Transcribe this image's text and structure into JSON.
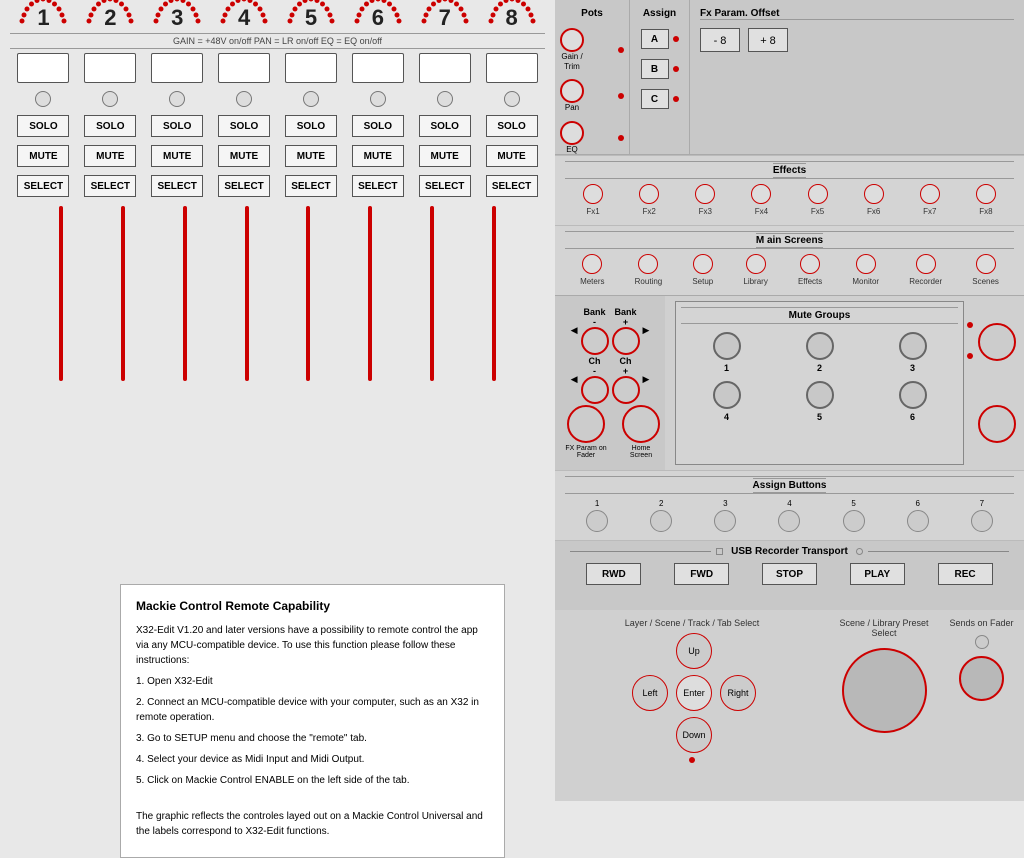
{
  "channels": {
    "numbers": [
      "1",
      "2",
      "3",
      "4",
      "5",
      "6",
      "7",
      "8"
    ],
    "gain_label": "GAIN = +48V on/off   PAN = LR on/off   EQ = EQ on/off",
    "solo_label": "SOLO",
    "mute_label": "MUTE",
    "select_label": "SELECT"
  },
  "pots": {
    "label": "Pots",
    "gain_trim": "Gain /\nTrim",
    "pan": "Pan",
    "eq": "EQ"
  },
  "assign": {
    "label": "Assign",
    "buttons": [
      "A",
      "B",
      "C"
    ]
  },
  "fx_param": {
    "title": "Fx Param. Offset",
    "minus8": "- 8",
    "plus8": "+ 8"
  },
  "effects": {
    "title": "Effects",
    "items": [
      "Fx1",
      "Fx2",
      "Fx3",
      "Fx4",
      "Fx5",
      "Fx6",
      "Fx7",
      "Fx8"
    ]
  },
  "main_screens": {
    "title": "M ain Screens",
    "items": [
      "Meters",
      "Routing",
      "Setup",
      "Library",
      "Effects",
      "Monitor",
      "Recorder",
      "Scenes"
    ]
  },
  "bank": {
    "bank_minus": "Bank\n-",
    "bank_plus": "Bank\n+",
    "ch_minus": "Ch\n-",
    "ch_plus": "Ch\n+"
  },
  "fx_home": {
    "fx_fader_label": "FX Param\non Fader",
    "home_label": "Home\nScreen"
  },
  "mute_groups": {
    "title": "Mute Groups",
    "numbers": [
      "1",
      "2",
      "3",
      "4",
      "5",
      "6"
    ]
  },
  "assign_buttons": {
    "title": "Assign Buttons",
    "numbers": [
      "1",
      "2",
      "3",
      "4",
      "5",
      "6",
      "7"
    ]
  },
  "usb_transport": {
    "label": "USB Recorder Transport",
    "buttons": [
      "RWD",
      "FWD",
      "STOP",
      "PLAY",
      "REC"
    ]
  },
  "navigation": {
    "layer_label": "Layer / Scene / Track / Tab Select",
    "scene_label": "Scene / Library\nPreset Select",
    "sends_label": "Sends on\nFader",
    "up": "Up",
    "down": "Down",
    "left": "Left",
    "right": "Right",
    "enter": "Enter"
  },
  "info_box": {
    "title": "Mackie Control Remote Capability",
    "para1": "X32-Edit V1.20 and later versions have a possibility to remote control the app via any MCU-compatible device. To use this function please follow these instructions:",
    "step1": "1. Open X32-Edit",
    "step2": "2. Connect an MCU-compatible device with your computer, such as an X32 in remote operation.",
    "step3": "3. Go to SETUP menu and choose the \"remote\" tab.",
    "step4": "4. Select your device as Midi Input and Midi Output.",
    "step5": "5. Click on Mackie Control ENABLE on the left side of the tab.",
    "footer": "The graphic reflects the controles layed out on a Mackie Control Universal and the labels correspond to X32-Edit functions."
  }
}
